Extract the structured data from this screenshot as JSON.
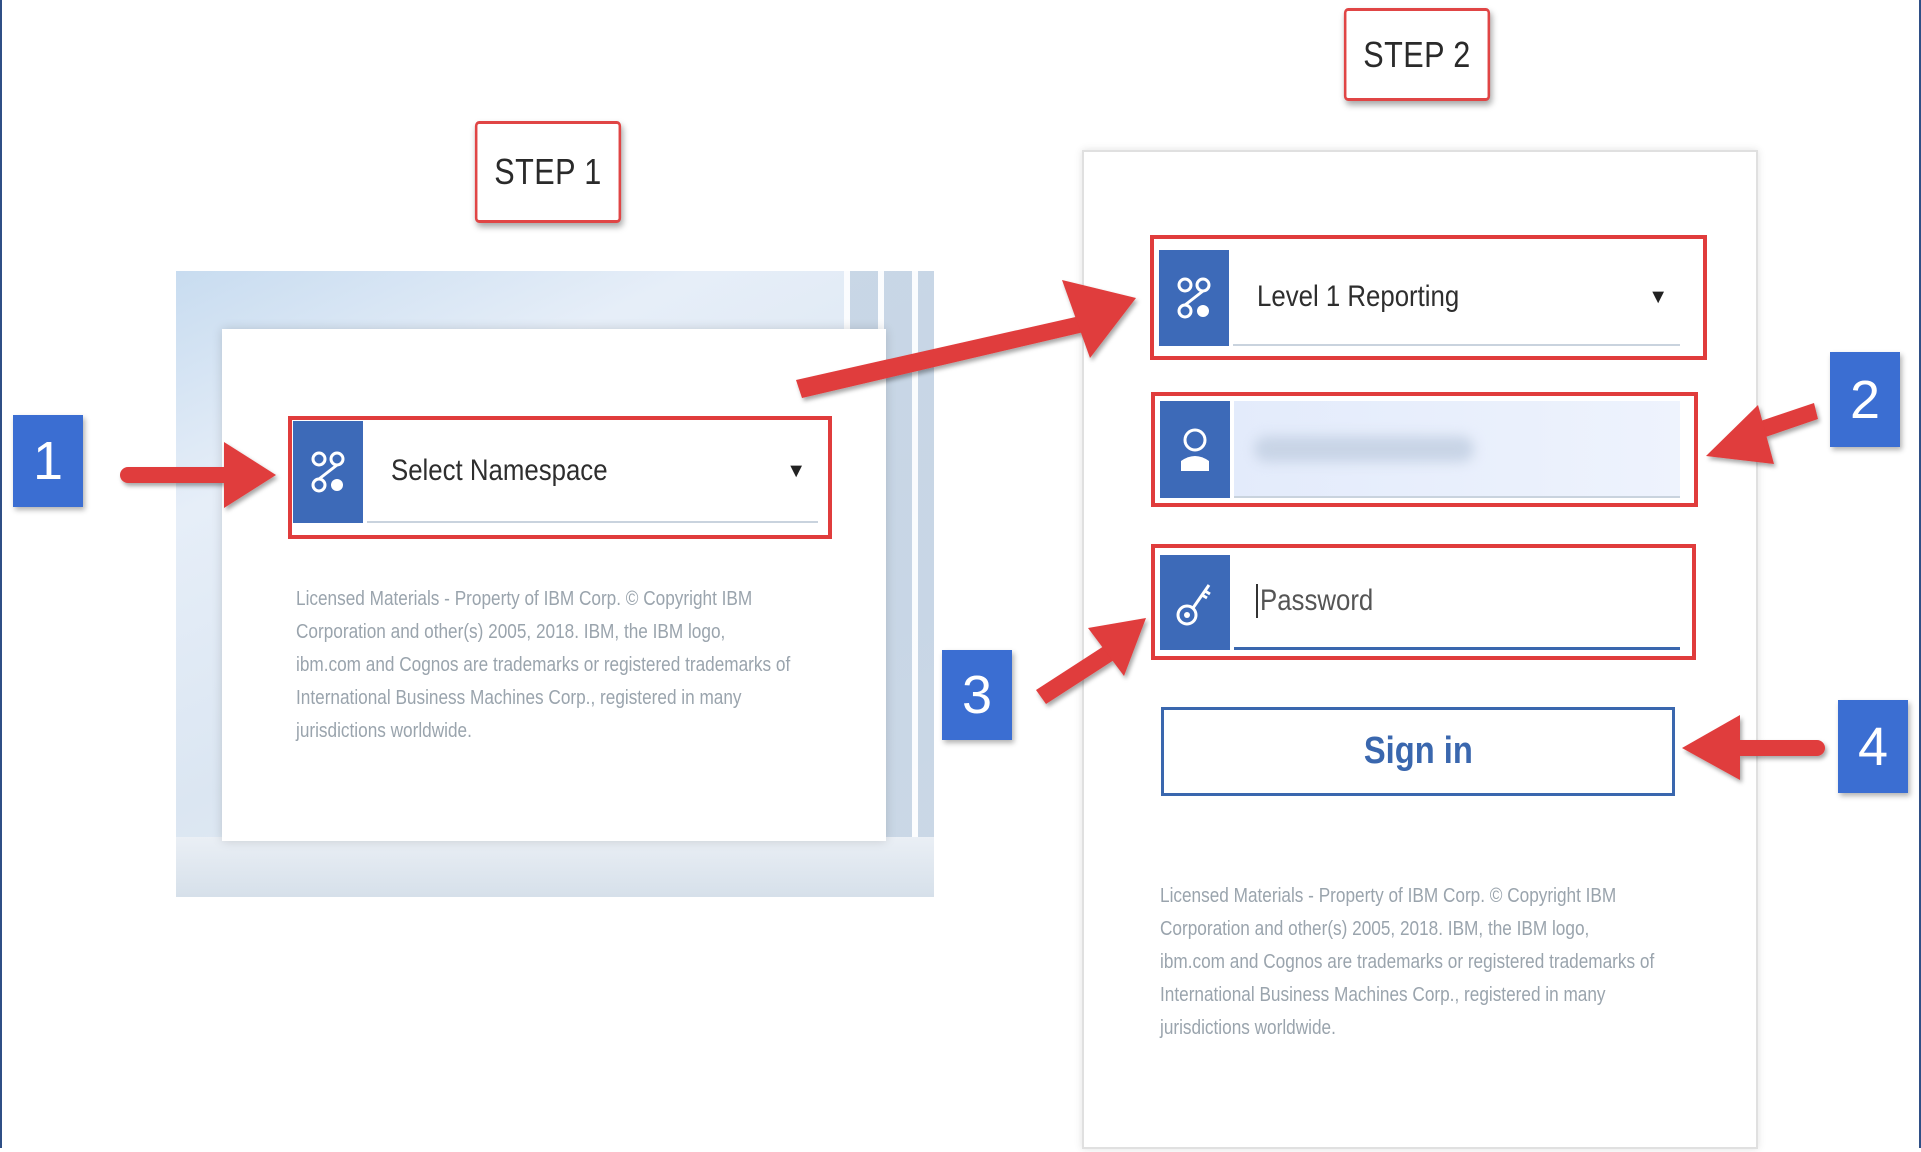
{
  "steps": {
    "step1": "STEP 1",
    "step2": "STEP 2"
  },
  "step1_panel": {
    "namespace_select": {
      "label": "Select Namespace",
      "caret": "▼",
      "icon": "namespace-icon"
    },
    "legal_text": "Licensed Materials - Property of IBM Corp. © Copyright IBM Corporation and other(s) 2005, 2018. IBM, the IBM logo, ibm.com and Cognos are trademarks or registered trademarks of International Business Machines Corp., registered in many jurisdictions worldwide."
  },
  "step2_panel": {
    "namespace_select": {
      "label": "Level 1 Reporting",
      "caret": "▼",
      "icon": "namespace-icon"
    },
    "username_field": {
      "value": "",
      "icon": "user-icon"
    },
    "password_field": {
      "placeholder": "Password",
      "icon": "key-icon"
    },
    "signin_button": {
      "label": "Sign in"
    },
    "legal_text": "Licensed Materials - Property of IBM Corp. © Copyright IBM Corporation and other(s) 2005, 2018. IBM, the IBM logo, ibm.com and Cognos are trademarks or registered trademarks of International Business Machines Corp., registered in many jurisdictions worldwide."
  },
  "callouts": {
    "c1": "1",
    "c2": "2",
    "c3": "3",
    "c4": "4"
  },
  "colors": {
    "accent_blue": "#3d6ab8",
    "highlight_red": "#e03c3c",
    "badge_blue": "#3b6ed2"
  }
}
